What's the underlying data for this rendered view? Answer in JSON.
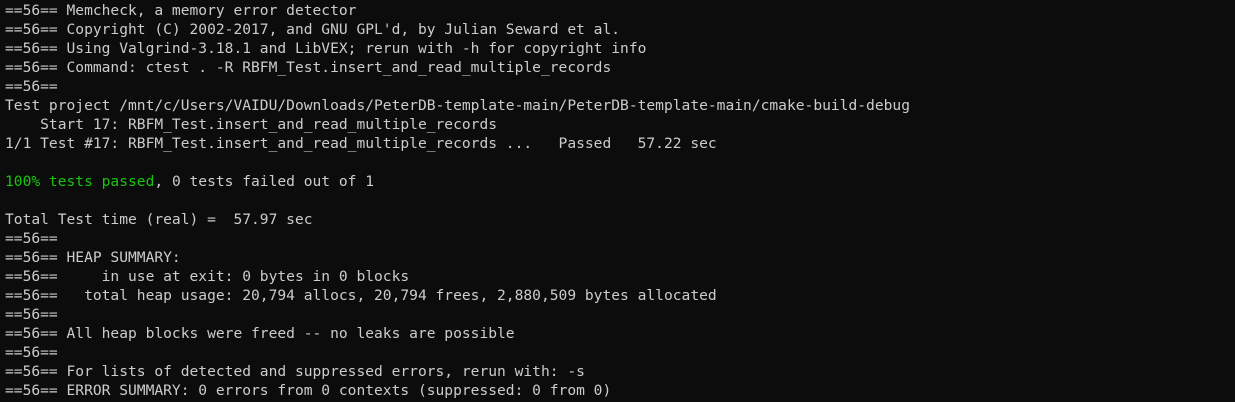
{
  "terminal": {
    "lines": [
      "==56== Memcheck, a memory error detector",
      "==56== Copyright (C) 2002-2017, and GNU GPL'd, by Julian Seward et al.",
      "==56== Using Valgrind-3.18.1 and LibVEX; rerun with -h for copyright info",
      "==56== Command: ctest . -R RBFM_Test.insert_and_read_multiple_records",
      "==56==",
      "Test project /mnt/c/Users/VAIDU/Downloads/PeterDB-template-main/PeterDB-template-main/cmake-build-debug",
      "    Start 17: RBFM_Test.insert_and_read_multiple_records",
      "1/1 Test #17: RBFM_Test.insert_and_read_multiple_records ...   Passed   57.22 sec",
      "",
      "",
      "",
      "Total Test time (real) =  57.97 sec",
      "==56==",
      "==56== HEAP SUMMARY:",
      "==56==     in use at exit: 0 bytes in 0 blocks",
      "==56==   total heap usage: 20,794 allocs, 20,794 frees, 2,880,509 bytes allocated",
      "==56==",
      "==56== All heap blocks were freed -- no leaks are possible",
      "==56==",
      "==56== For lists of detected and suppressed errors, rerun with: -s",
      "==56== ERROR SUMMARY: 0 errors from 0 contexts (suppressed: 0 from 0)"
    ],
    "summary_passed": "100% tests passed",
    "summary_rest": ", 0 tests failed out of 1"
  },
  "colors": {
    "background": "#0c0c0c",
    "text": "#cccccc",
    "success": "#16c60c"
  }
}
